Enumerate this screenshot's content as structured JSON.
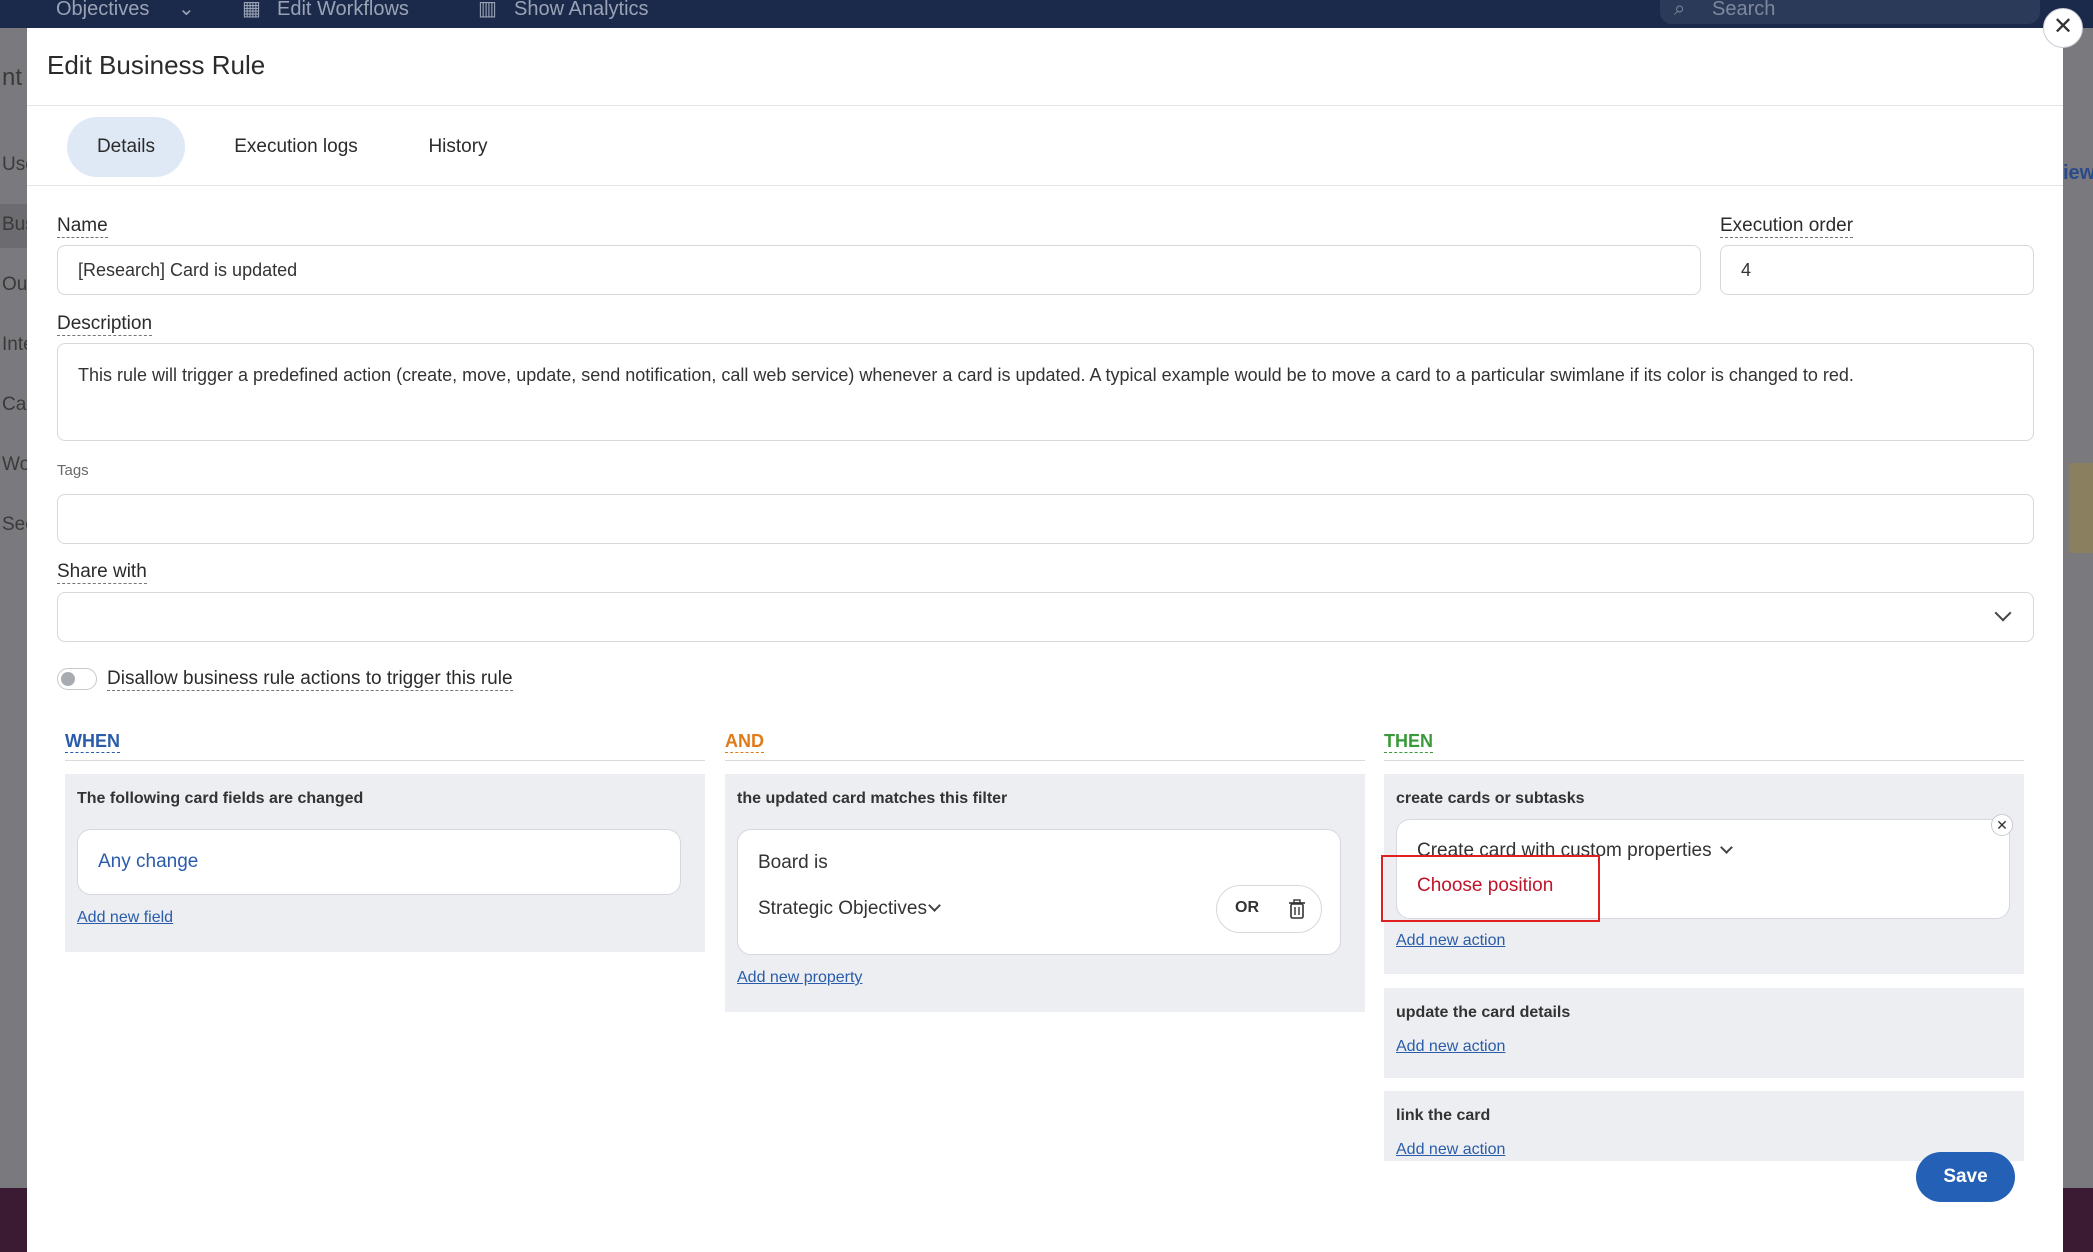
{
  "background": {
    "topbar": {
      "objectives": "Objectives",
      "edit_workflows": "Edit Workflows",
      "show_analytics": "Show Analytics",
      "search_placeholder": "Search"
    },
    "left_partial": [
      "nt",
      "Use",
      "Bus",
      "Out",
      "Inte",
      "Car",
      "Wo",
      "Sec"
    ],
    "right_partial": "iew"
  },
  "modal": {
    "title": "Edit Business Rule",
    "tabs": [
      {
        "label": "Details",
        "active": true
      },
      {
        "label": "Execution logs",
        "active": false
      },
      {
        "label": "History",
        "active": false
      }
    ],
    "name": {
      "label": "Name",
      "value": "[Research] Card is updated"
    },
    "execution_order": {
      "label": "Execution order",
      "value": "4"
    },
    "description": {
      "label": "Description",
      "value": "This rule will trigger a predefined action (create, move, update, send notification, call web service) whenever a card is updated. A typical example would be to move a card to a particular swimlane if its color is changed to red."
    },
    "tags": {
      "label": "Tags",
      "value": ""
    },
    "share_with": {
      "label": "Share with",
      "value": ""
    },
    "toggle": {
      "label": "Disallow business rule actions to trigger this rule",
      "enabled": false
    },
    "when": {
      "heading": "WHEN",
      "color": "#2a5caa",
      "panel_title": "The following card fields are changed",
      "chip": "Any change",
      "add_link": "Add new field"
    },
    "and": {
      "heading": "AND",
      "color": "#e07b1a",
      "panel_title": "the updated card matches this filter",
      "filter_label": "Board is",
      "filter_value": "Strategic Objectives",
      "or_label": "OR",
      "add_link": "Add new property"
    },
    "then": {
      "heading": "THEN",
      "color": "#3a9a3a",
      "panels": [
        {
          "title": "create cards or subtasks",
          "action_select": "Create card with custom properties",
          "action_warning": "Choose position",
          "add_link": "Add new action"
        },
        {
          "title": "update the card details",
          "add_link": "Add new action"
        },
        {
          "title": "link the card",
          "add_link": "Add new action"
        }
      ]
    },
    "save_label": "Save"
  }
}
